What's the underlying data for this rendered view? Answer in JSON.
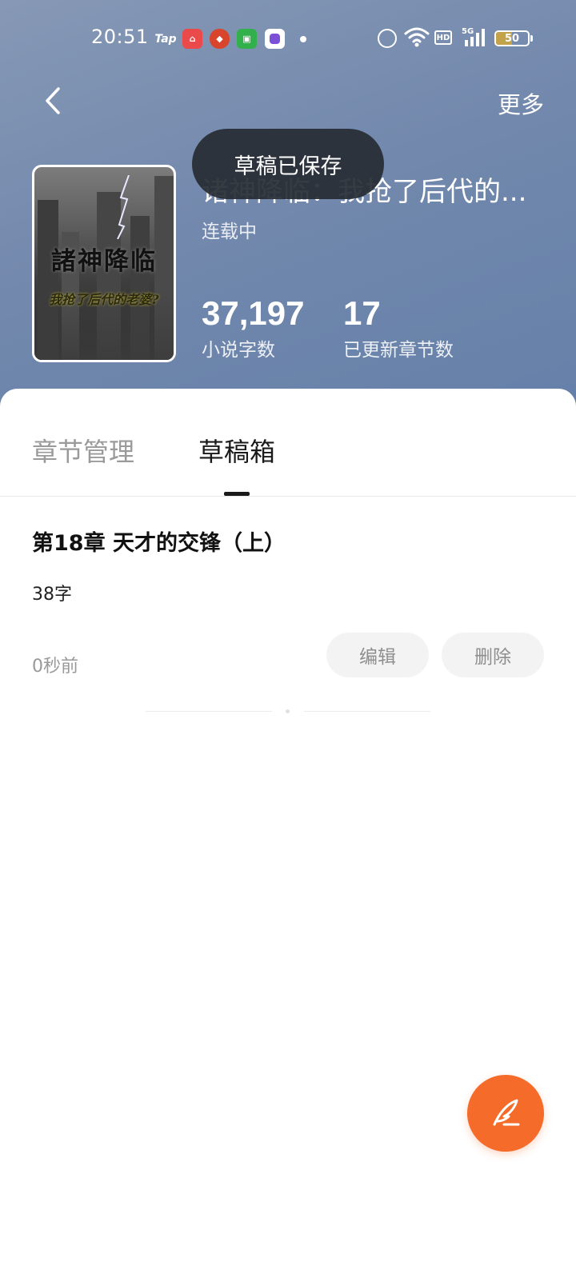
{
  "status_bar": {
    "time": "20:51",
    "tap_label": "Tap",
    "hd_label": "HD",
    "network_label": "5G",
    "battery_level": "50",
    "battery_fraction": 0.5
  },
  "nav": {
    "back_icon": "chevron-left-icon",
    "more_label": "更多"
  },
  "toast": {
    "message": "草稿已保存"
  },
  "book": {
    "cover_title": "諸神降临",
    "cover_subtitle": "我抢了后代的老婆?",
    "title": "诸神降临：我抢了后代的...",
    "status": "连载中",
    "word_count": "37,197",
    "word_count_label": "小说字数",
    "chapter_count": "17",
    "chapter_count_label": "已更新章节数"
  },
  "tabs": [
    {
      "label": "章节管理",
      "active": false
    },
    {
      "label": "草稿箱",
      "active": true
    }
  ],
  "drafts": [
    {
      "title": "第18章 天才的交锋（上）",
      "words": "38字",
      "time": "0秒前",
      "edit_label": "编辑",
      "delete_label": "删除"
    }
  ],
  "fab": {
    "icon": "quill-pen-icon"
  },
  "colors": {
    "header_bg": "#7389ad",
    "accent": "#f56b2a",
    "toast_bg": "#282c34"
  }
}
